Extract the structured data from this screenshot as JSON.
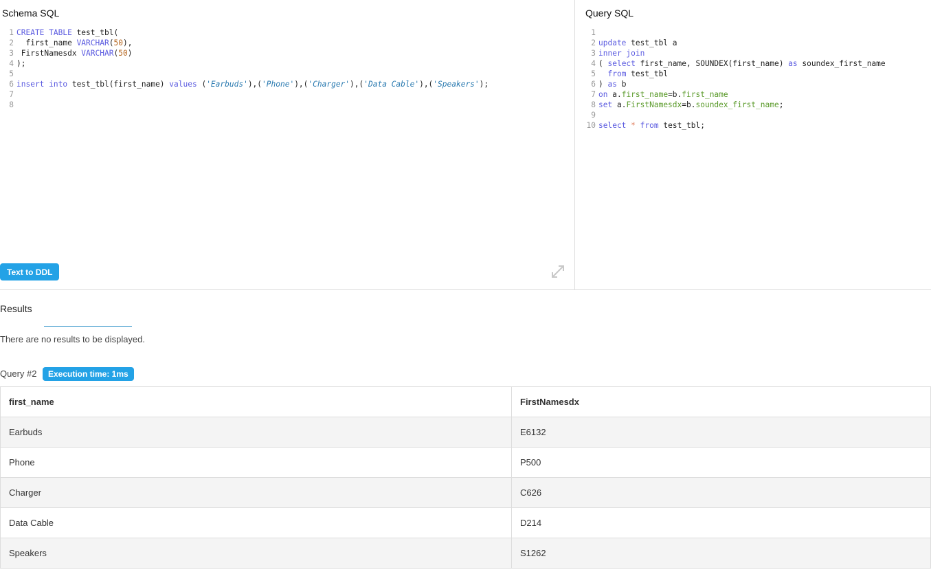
{
  "schema": {
    "title": "Schema SQL",
    "lines": [
      {
        "n": "1",
        "html": "<span class='kw'>CREATE TABLE</span> test_tbl("
      },
      {
        "n": "2",
        "html": "  first_name <span class='kw'>VARCHAR</span>(<span class='num'>50</span>),"
      },
      {
        "n": "3",
        "html": " FirstNamesdx <span class='kw'>VARCHAR</span>(<span class='num'>50</span>)"
      },
      {
        "n": "4",
        "html": ");"
      },
      {
        "n": "5",
        "html": ""
      },
      {
        "n": "6",
        "html": "<span class='kw'>insert into</span> test_tbl(first_name) <span class='kw'>values</span> (<span class='str'>'Earbuds'</span>),(<span class='str'>'Phone'</span>),(<span class='str'>'Charger'</span>),(<span class='str'>'Data Cable'</span>),(<span class='str'>'Speakers'</span>);"
      },
      {
        "n": "7",
        "html": ""
      },
      {
        "n": "8",
        "html": ""
      }
    ],
    "text_to_ddl_label": "Text to DDL"
  },
  "query": {
    "title": "Query SQL",
    "lines": [
      {
        "n": "1",
        "html": ""
      },
      {
        "n": "2",
        "html": "<span class='kw'>update</span> test_tbl a"
      },
      {
        "n": "3",
        "html": "<span class='kw'>inner join</span>"
      },
      {
        "n": "4",
        "html": "( <span class='kw'>select</span> first_name, SOUNDEX(first_name) <span class='kw'>as</span> soundex_first_name"
      },
      {
        "n": "5",
        "html": "  <span class='kw'>from</span> test_tbl"
      },
      {
        "n": "6",
        "html": ") <span class='kw'>as</span> b"
      },
      {
        "n": "7",
        "html": "<span class='kw'>on</span> a.<span class='grn'>first_name</span>=b.<span class='grn'>first_name</span>"
      },
      {
        "n": "8",
        "html": "<span class='kw'>set</span> a.<span class='grn'>FirstNamesdx</span>=b.<span class='grn'>soundex_first_name</span>;"
      },
      {
        "n": "9",
        "html": ""
      },
      {
        "n": "10",
        "html": "<span class='kw'>select</span> <span class='op'>*</span> <span class='kw'>from</span> test_tbl;"
      }
    ]
  },
  "results": {
    "title": "Results",
    "empty_message": "There are no results to be displayed.",
    "query_label": "Query #2",
    "execution_time": "Execution time: 1ms",
    "columns": [
      "first_name",
      "FirstNamesdx"
    ],
    "rows": [
      [
        "Earbuds",
        "E6132"
      ],
      [
        "Phone",
        "P500"
      ],
      [
        "Charger",
        "C626"
      ],
      [
        "Data Cable",
        "D214"
      ],
      [
        "Speakers",
        "S1262"
      ]
    ]
  }
}
